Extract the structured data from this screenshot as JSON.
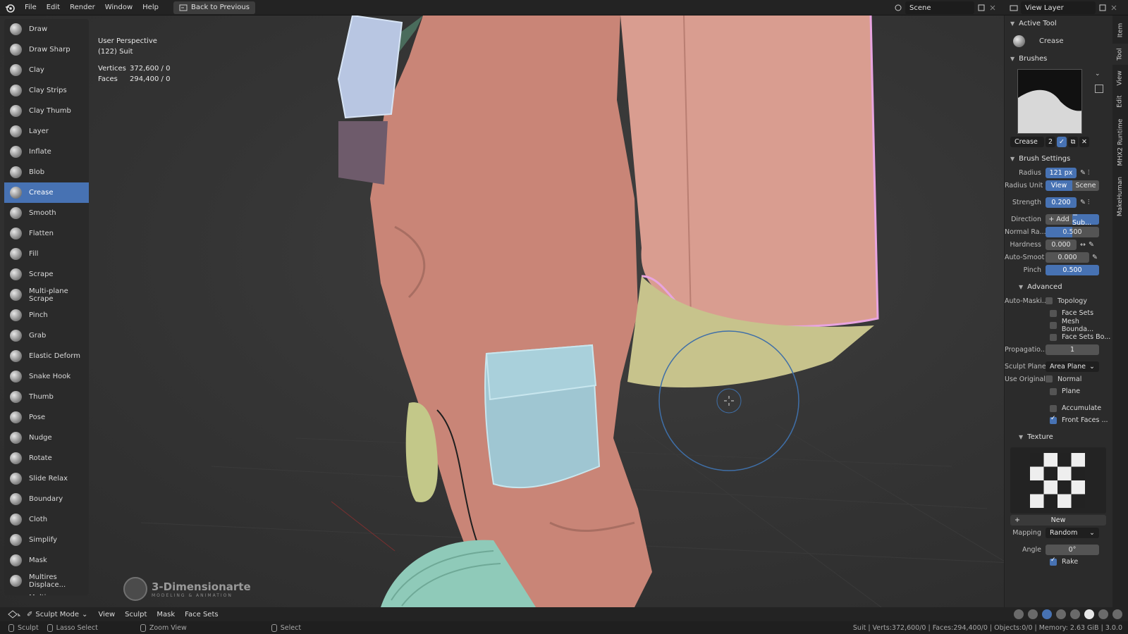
{
  "topbar": {
    "menus": [
      "File",
      "Edit",
      "Render",
      "Window",
      "Help"
    ],
    "back_button": "Back to Previous",
    "scene_name": "Scene",
    "view_layer": "View Layer"
  },
  "viewport": {
    "perspective": "User Perspective",
    "object": "(122) Suit",
    "stats": {
      "vertices_label": "Vertices",
      "vertices_value": "372,600 / 0",
      "faces_label": "Faces",
      "faces_value": "294,400 / 0"
    },
    "watermark_title": "3-Dimensionarte",
    "watermark_sub": "MODELING & ANIMATION"
  },
  "tools": [
    "Draw",
    "Draw Sharp",
    "Clay",
    "Clay Strips",
    "Clay Thumb",
    "Layer",
    "Inflate",
    "Blob",
    "Crease",
    "Smooth",
    "Flatten",
    "Fill",
    "Scrape",
    "Multi-plane Scrape",
    "Pinch",
    "Grab",
    "Elastic Deform",
    "Snake Hook",
    "Thumb",
    "Pose",
    "Nudge",
    "Rotate",
    "Slide Relax",
    "Boundary",
    "Cloth",
    "Simplify",
    "Mask",
    "Multires Displace...",
    "Multires Displace..."
  ],
  "active_tool_index": 8,
  "props": {
    "active_tool_title": "Active Tool",
    "active_tool_name": "Crease",
    "brushes_title": "Brushes",
    "brush_name": "Crease",
    "brush_users": "2",
    "brush_settings_title": "Brush Settings",
    "radius_label": "Radius",
    "radius_value": "121 px",
    "radius_unit_label": "Radius Unit",
    "radius_unit_view": "View",
    "radius_unit_scene": "Scene",
    "strength_label": "Strength",
    "strength_value": "0.200",
    "direction_label": "Direction",
    "direction_add": "+ Add",
    "direction_sub": "− Sub...",
    "normal_radius_label": "Normal Ra...",
    "normal_radius_value": "0.500",
    "hardness_label": "Hardness",
    "hardness_value": "0.000",
    "autosmooth_label": "Auto-Smoot",
    "autosmooth_value": "0.000",
    "pinch_label": "Pinch",
    "pinch_value": "0.500",
    "advanced_title": "Advanced",
    "automasking_label": "Auto-Maski...",
    "automasking_options": [
      "Topology",
      "Face Sets",
      "Mesh Bounda...",
      "Face Sets Bo..."
    ],
    "propagation_label": "Propagatio...",
    "propagation_value": "1",
    "sculpt_plane_label": "Sculpt Plane",
    "sculpt_plane_value": "Area Plane",
    "use_original_label": "Use Original",
    "use_original_options": [
      "Normal",
      "Plane"
    ],
    "accumulate_label": "Accumulate",
    "front_faces_label": "Front Faces ...",
    "texture_title": "Texture",
    "texture_new": "New",
    "mapping_label": "Mapping",
    "mapping_value": "Random",
    "angle_label": "Angle",
    "angle_value": "0°",
    "rake_label": "Rake"
  },
  "vtabs": [
    "Item",
    "Tool",
    "View",
    "Edit",
    "MHX2 Runtime",
    "MakeHuman"
  ],
  "modebar": {
    "mode": "Sculpt Mode",
    "menus": [
      "View",
      "Sculpt",
      "Mask",
      "Face Sets"
    ]
  },
  "statusbar": {
    "sculpt": "Sculpt",
    "lasso": "Lasso Select",
    "zoom": "Zoom View",
    "select": "Select",
    "info": "Suit | Verts:372,600/0 | Faces:294,400/0 | Objects:0/0 | Memory: 2.63 GiB | 3.0.0"
  },
  "colors": {
    "accent": "#4772b3",
    "suit": "#c98577",
    "pocket": "#9fc6d2",
    "backpack": "#d99d90",
    "selection_outline": "#e8a4e0"
  }
}
